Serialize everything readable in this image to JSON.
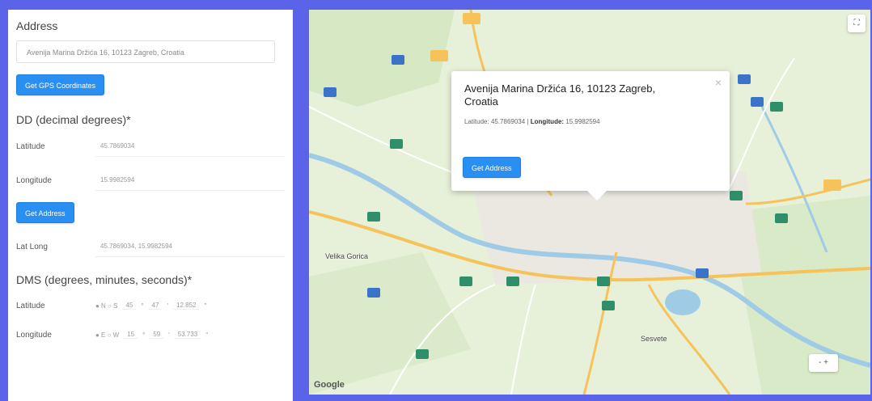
{
  "left": {
    "address_label": "Address",
    "address_value": "Avenija Marina Držića 16, 10123 Zagreb, Croatia",
    "get_gps_button": "Get GPS Coordinates",
    "dd_title": "DD (decimal degrees)*",
    "latitude_label": "Latitude",
    "latitude_value": "45.7869034",
    "longitude_label": "Longitude",
    "longitude_value": "15.9982594",
    "get_address_button": "Get Address",
    "latlong_label": "Lat Long",
    "latlong_value": "45.7869034, 15.9982594",
    "dms_title": "DMS (degrees, minutes, seconds)*",
    "dms_lat_label": "Latitude",
    "dms_lat_fields": [
      "● N ○ S",
      "45",
      "°",
      "47",
      "'",
      "12.852",
      "\""
    ],
    "dms_lng_label": "Longitude",
    "dms_lng_fields": [
      "● E ○ W",
      "15",
      "°",
      "59",
      "'",
      "53.733",
      "\""
    ]
  },
  "map": {
    "popup_address": "Avenija Marina Držića 16, 10123 Zagreb, Croatia",
    "popup_lat_label": "Latitude:",
    "popup_lat_value": "45.7869034",
    "popup_lng_label": "Longitude:",
    "popup_lng_value": "15.9982594",
    "popup_button": "Get Address",
    "popup_close": "×",
    "fullscreen_icon": "⛶",
    "zoom_ctrl": "- +",
    "places": [
      "Velika Gorica",
      "Sesvete"
    ],
    "google_logo": "Google",
    "colors": {
      "land": "#e7f0d8",
      "road": "#ffffff",
      "highway": "#f6c35b",
      "water": "#9fcbe6",
      "route_shield": "#2f8f6a"
    }
  }
}
